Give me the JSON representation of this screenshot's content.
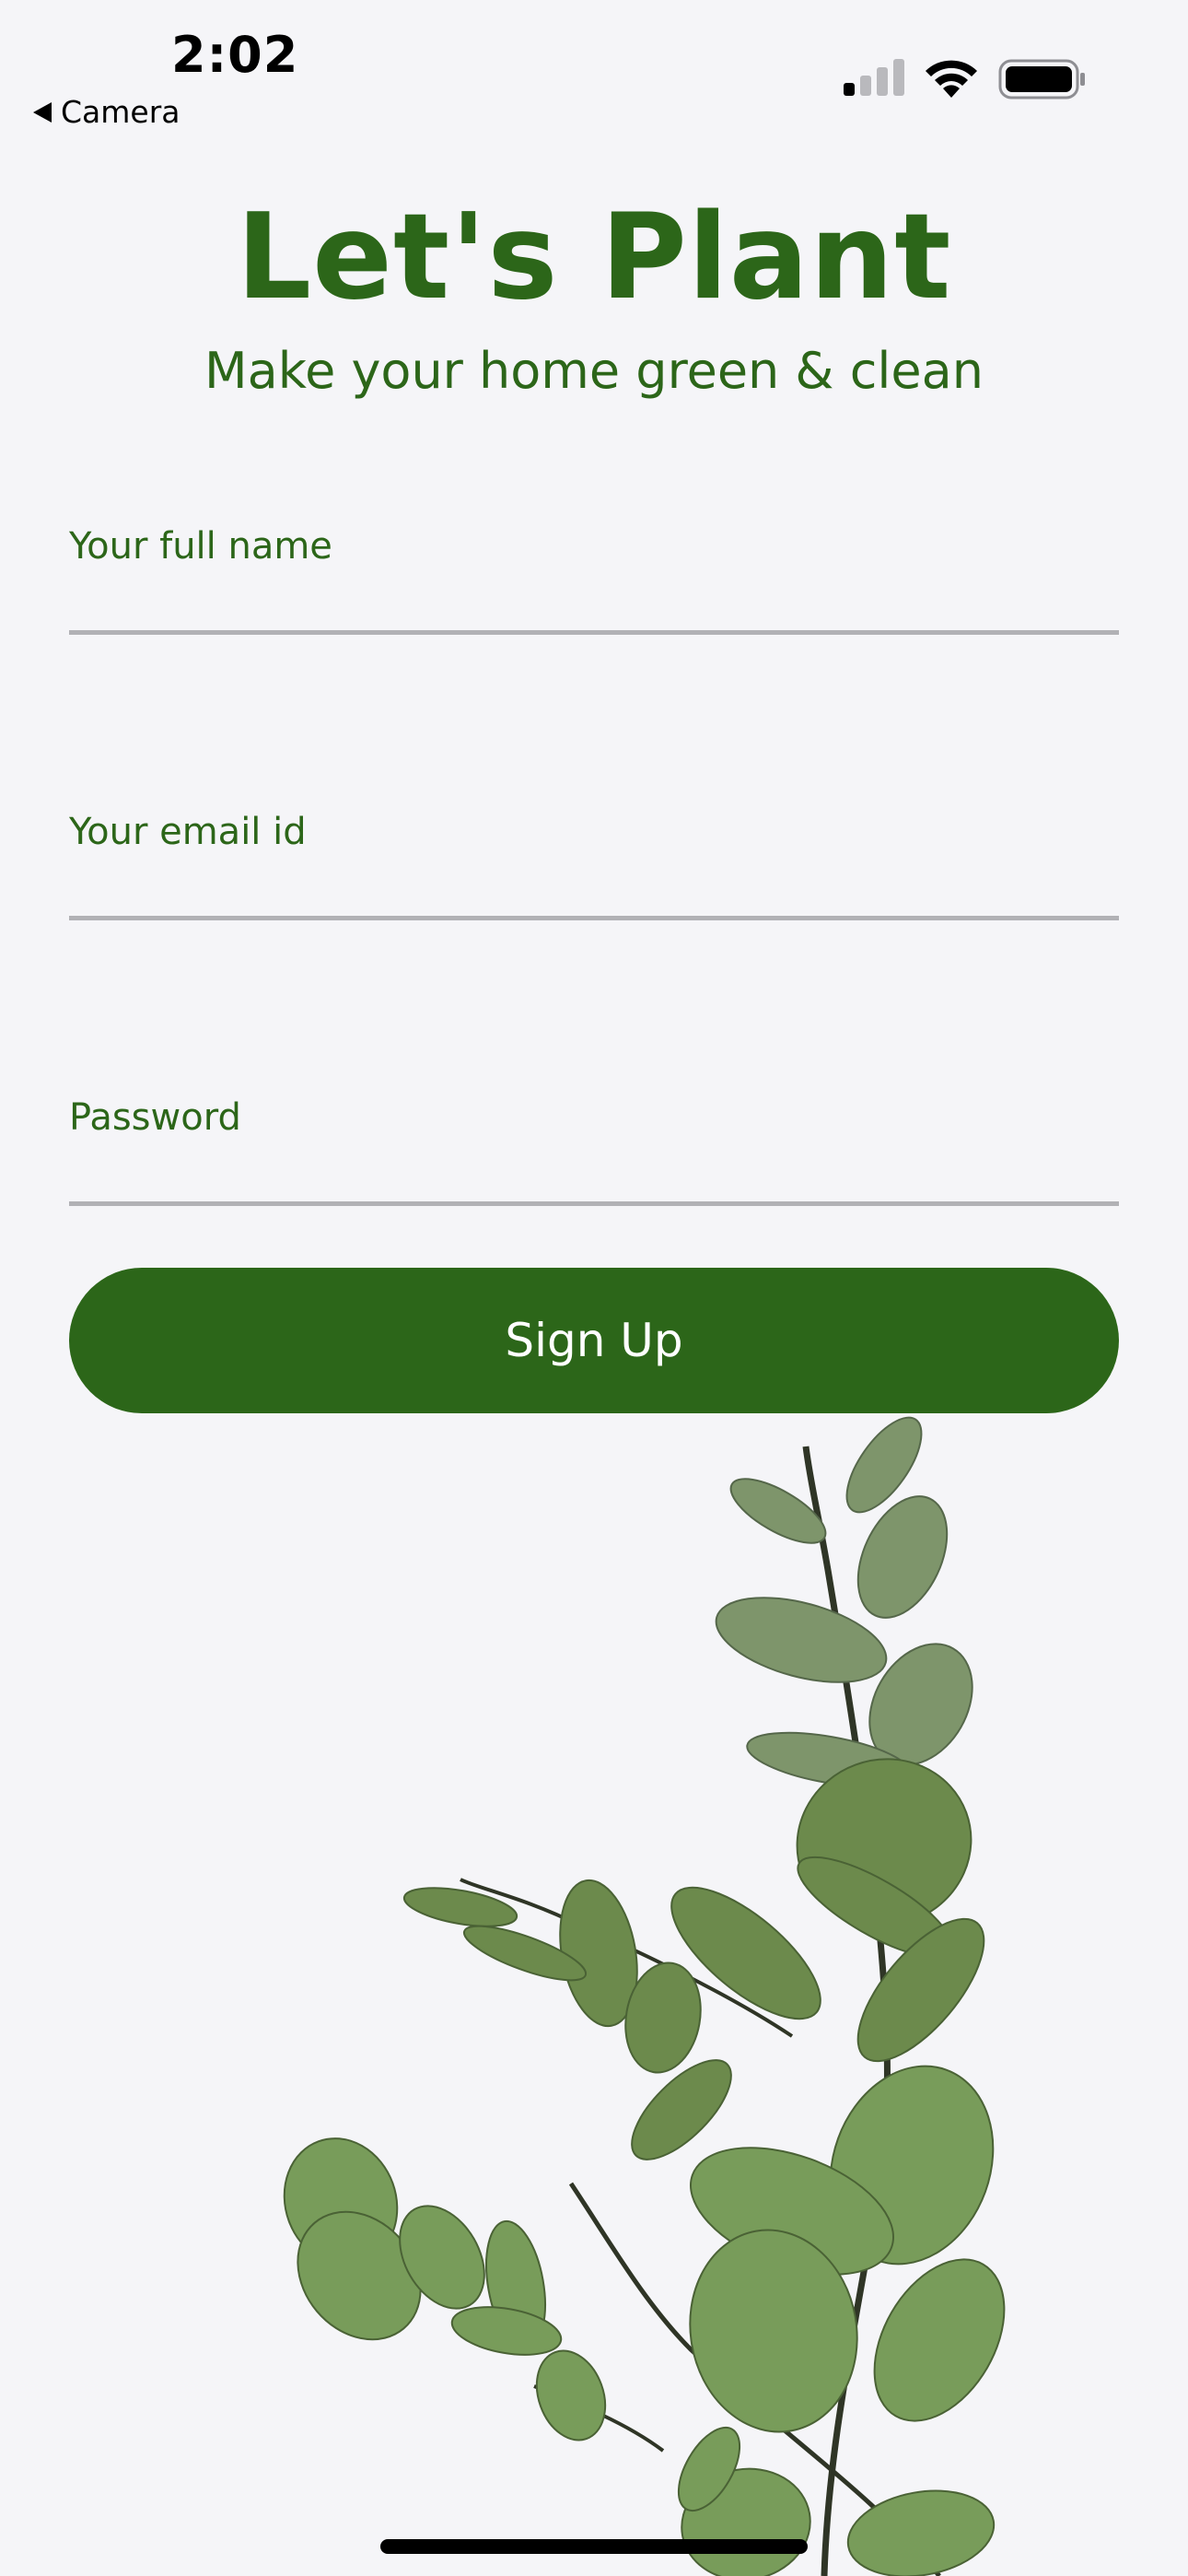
{
  "status_bar": {
    "time": "2:02",
    "back_label": "Camera",
    "signal_icon": "cellular-signal-icon",
    "wifi_icon": "wifi-icon",
    "battery_icon": "battery-icon"
  },
  "header": {
    "title": "Let's Plant",
    "subtitle": "Make your home green & clean"
  },
  "form": {
    "fields": [
      {
        "label": "Your full name",
        "value": ""
      },
      {
        "label": "Your email id",
        "value": ""
      },
      {
        "label": "Password",
        "value": ""
      }
    ],
    "submit_label": "Sign Up"
  },
  "colors": {
    "brand_green": "#2c6619",
    "background": "#f5f5f8",
    "underline": "#b1b1b5"
  }
}
